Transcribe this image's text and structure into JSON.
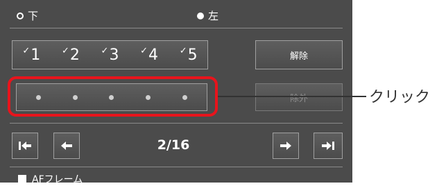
{
  "select_target": {
    "options": [
      {
        "label": "下",
        "selected": false
      },
      {
        "label": "左",
        "selected": true
      }
    ]
  },
  "ratings": [
    {
      "label": "1"
    },
    {
      "label": "2"
    },
    {
      "label": "3"
    },
    {
      "label": "4"
    },
    {
      "label": "5"
    }
  ],
  "buttons": {
    "release_label": "解除",
    "exclude_label": "除外"
  },
  "navigation": {
    "page_indicator": "2/16"
  },
  "af_frame_label": "AFフレーム",
  "annotation": {
    "click_label": "クリック",
    "highlight_color": "#e8141c"
  }
}
